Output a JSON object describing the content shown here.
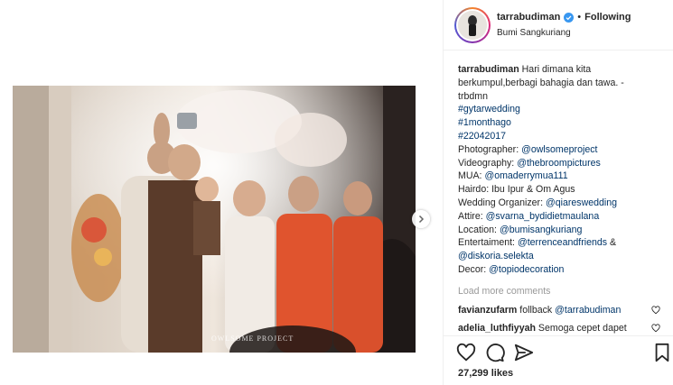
{
  "post": {
    "username": "tarrabudiman",
    "follow_separator": "•",
    "follow_status": "Following",
    "location": "Bumi Sangkuriang",
    "photo_watermark": "OWLSOME PROJECT",
    "caption": {
      "author": "tarrabudiman",
      "text_line1": "Hari dimana kita",
      "text_line2": "berkumpul,berbagi bahagia dan tawa. -",
      "text_line3": "trbdmn",
      "hashtag1": "#gytarwedding",
      "hashtag2": "#1monthago",
      "hashtag3": "#22042017",
      "photographer_label": "Photographer: ",
      "photographer": "@owlsomeproject",
      "videography_label": "Videography: ",
      "videography": "@thebroompictures",
      "mua_label": "MUA: ",
      "mua": "@omaderrymua111",
      "hairdo": "Hairdo: Ibu Ipur & Om Agus",
      "wo_label": "Wedding Organizer: ",
      "wo": "@qiareswedding",
      "attire_label": "Attire: ",
      "attire": "@svarna_bydidietmaulana",
      "location_label": "Location: ",
      "location": "@bumisangkuriang",
      "entertainment_label": "Entertaiment: ",
      "entertainment1": "@terrenceandfriends",
      "entertainment_amp": " &",
      "entertainment2": "@diskoria.selekta",
      "decor_label": "Decor: ",
      "decor": "@topiodecoration"
    },
    "load_more": "Load more comments",
    "comments": [
      {
        "user": "favianzufarm",
        "text": " follback ",
        "mention": "@tarrabudiman"
      },
      {
        "user": "adelia_luthfiyyah",
        "text": " Semoga cepet dapet",
        "mention": ""
      }
    ],
    "likes": "27,299 likes"
  },
  "icons": {
    "verified": "verified-badge-icon",
    "next": "chevron-right-icon",
    "like": "heart-icon",
    "comment": "comment-bubble-icon",
    "save": "bookmark-icon"
  },
  "colors": {
    "link": "#003569",
    "verified": "#3897f0",
    "muted": "#999999",
    "text": "#262626"
  }
}
